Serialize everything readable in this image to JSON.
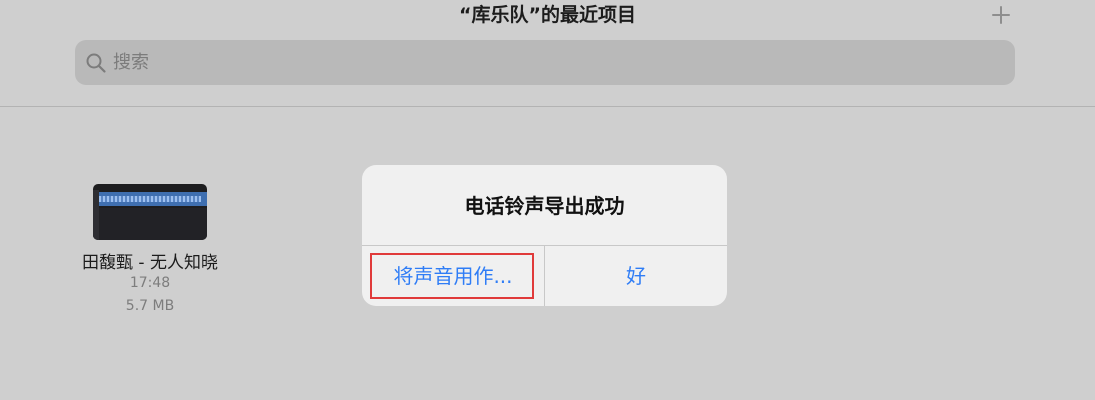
{
  "header": {
    "title": "“库乐队”的最近项目",
    "add_icon": "plus-icon"
  },
  "search": {
    "placeholder": "搜索",
    "icon": "search-icon"
  },
  "files": [
    {
      "name": "田馥甄 - 无人知晓",
      "time": "17:48",
      "size": "5.7 MB"
    }
  ],
  "alert": {
    "title": "电话铃声导出成功",
    "buttons": {
      "use_sound_as": "将声音用作...",
      "ok": "好"
    },
    "highlight_color": "#e03a3a",
    "button_color": "#2f7df6"
  }
}
